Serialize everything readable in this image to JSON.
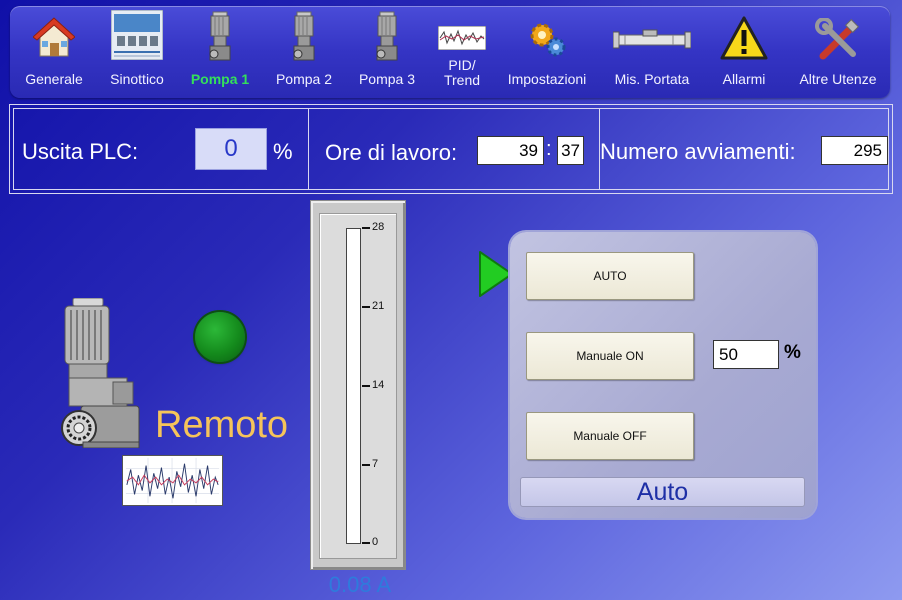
{
  "nav": {
    "items": [
      {
        "label": "Generale",
        "icon": "house-icon"
      },
      {
        "label": "Sinottico",
        "icon": "synoptic-icon"
      },
      {
        "label": "Pompa 1",
        "icon": "pump-icon",
        "active": true
      },
      {
        "label": "Pompa 2",
        "icon": "pump-icon"
      },
      {
        "label": "Pompa 3",
        "icon": "pump-icon"
      },
      {
        "label": "PID/\nTrend",
        "icon": "trend-icon"
      },
      {
        "label": "Impostazioni",
        "icon": "gears-icon"
      },
      {
        "label": "Mis. Portata",
        "icon": "flowmeter-icon"
      },
      {
        "label": "Allarmi",
        "icon": "warning-icon"
      },
      {
        "label": "Altre Utenze",
        "icon": "tools-icon"
      }
    ],
    "active_color": "#34e05a"
  },
  "info": {
    "plc_label": "Uscita PLC:",
    "plc_value": "0",
    "plc_unit": "%",
    "hours_label": "Ore di lavoro:",
    "hours_value": "39",
    "hours_separator": ":",
    "minutes_value": "37",
    "starts_label": "Numero avviamenti:",
    "starts_value": "295"
  },
  "pump": {
    "mode_text": "Remoto",
    "status_led_color": "#148a1c"
  },
  "gauge": {
    "ticks": [
      "28",
      "21",
      "14",
      "7",
      "0"
    ],
    "min": 0,
    "max": 28,
    "reading": "0.08 A"
  },
  "control": {
    "btn_auto": "AUTO",
    "btn_manual_on": "Manuale ON",
    "btn_manual_off": "Manuale OFF",
    "manual_value": "50",
    "manual_unit": "%",
    "status": "Auto",
    "selected": "auto"
  },
  "colors": {
    "selector_arrow": "#22cc22",
    "remoto_text": "#f5c45a",
    "gauge_reading": "#2e7bdc",
    "status_text": "#1e2fa6"
  }
}
